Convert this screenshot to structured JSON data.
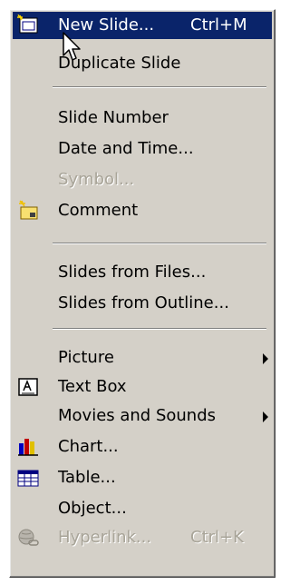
{
  "menu": {
    "new_slide": {
      "label": "New Slide...",
      "accelerator": "Ctrl+M"
    },
    "duplicate_slide": {
      "label": "Duplicate Slide"
    },
    "slide_number": {
      "label": "Slide Number"
    },
    "date_and_time": {
      "label": "Date and Time..."
    },
    "symbol": {
      "label": "Symbol..."
    },
    "comment": {
      "label": "Comment"
    },
    "slides_from_files": {
      "label": "Slides from Files..."
    },
    "slides_from_outline": {
      "label": "Slides from Outline..."
    },
    "picture": {
      "label": "Picture"
    },
    "text_box": {
      "label": "Text Box"
    },
    "movies_and_sounds": {
      "label": "Movies and Sounds"
    },
    "chart": {
      "label": "Chart..."
    },
    "table": {
      "label": "Table..."
    },
    "object": {
      "label": "Object..."
    },
    "hyperlink": {
      "label": "Hyperlink...",
      "accelerator": "Ctrl+K"
    }
  },
  "colors": {
    "menu_background": "#d4d0c8",
    "highlight": "#0a246a",
    "disabled_text": "#a8a498"
  }
}
